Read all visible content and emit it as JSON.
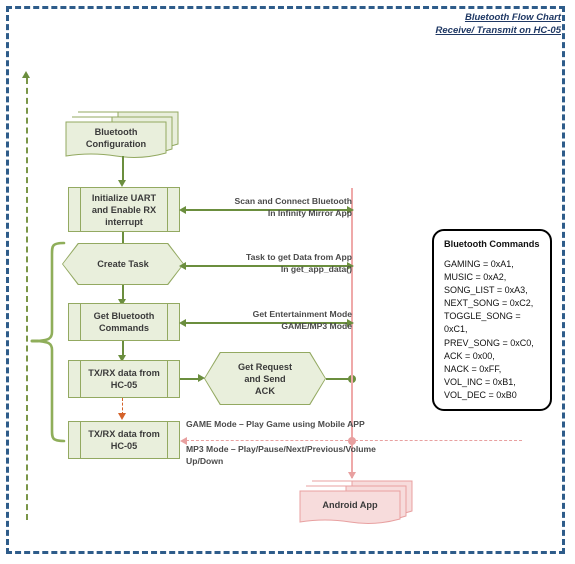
{
  "document": {
    "title_line1": "Bluetooth Flow Chart",
    "title_line2": "Receive/ Transmit on HC-05"
  },
  "colors": {
    "frame_border": "#2e5c8a",
    "title_text": "#1f3864",
    "node_fill_green": "#e9efdc",
    "node_border_green": "#93a961",
    "connector_green": "#6b8e3e",
    "connector_pink": "#efa9a9",
    "connector_orange": "#d4622a",
    "node_fill_pink": "#f7dcdc",
    "node_border_pink": "#e8a0a0",
    "label_text": "#4a4a4a"
  },
  "nodes": {
    "bluetooth_configuration": {
      "label": "Bluetooth\nConfiguration",
      "shape": "stacked-document"
    },
    "initialize_uart": {
      "label": "Initialize UART\nand Enable RX\ninterrupt",
      "shape": "process"
    },
    "create_task": {
      "label": "Create Task",
      "shape": "hexagon"
    },
    "get_bluetooth_commands": {
      "label": "Get Bluetooth\nCommands",
      "shape": "process"
    },
    "txrx_data_1": {
      "label": "TX/RX data from\nHC-05",
      "shape": "process"
    },
    "txrx_data_2": {
      "label": "TX/RX data from\nHC-05",
      "shape": "process"
    },
    "get_request_send_ack": {
      "label": "Get Request\nand Send\nACK",
      "shape": "hexagon"
    },
    "android_app": {
      "label": "Android App",
      "shape": "stacked-document"
    }
  },
  "arrow_labels": {
    "scan_connect": "Scan and Connect Bluetooth\nIn Infinity Mirror App",
    "task_get_data": "Task to get Data from App\nIn get_app_data()",
    "entertainment_mode": "Get Entertainment Mode\nGAME/MP3  Mode",
    "game_mode": "GAME Mode – Play Game using Mobile APP",
    "mp3_mode": "MP3 Mode – Play/Pause/Next/Previous/Volume\nUp/Down"
  },
  "commands_panel": {
    "heading": "Bluetooth Commands",
    "body": "GAMING = 0xA1,\nMUSIC = 0xA2,\nSONG_LIST = 0xA3,\nNEXT_SONG = 0xC2,\nTOGGLE_SONG =\n0xC1,\nPREV_SONG = 0xC0,\nACK = 0x00,\nNACK = 0xFF,\nVOL_INC = 0xB1,\nVOL_DEC = 0xB0",
    "commands": [
      {
        "name": "GAMING",
        "value": "0xA1"
      },
      {
        "name": "MUSIC",
        "value": "0xA2"
      },
      {
        "name": "SONG_LIST",
        "value": "0xA3"
      },
      {
        "name": "NEXT_SONG",
        "value": "0xC2"
      },
      {
        "name": "TOGGLE_SONG",
        "value": "0xC1"
      },
      {
        "name": "PREV_SONG",
        "value": "0xC0"
      },
      {
        "name": "ACK",
        "value": "0x00"
      },
      {
        "name": "NACK",
        "value": "0xFF"
      },
      {
        "name": "VOL_INC",
        "value": "0xB1"
      },
      {
        "name": "VOL_DEC",
        "value": "0xB0"
      }
    ]
  }
}
